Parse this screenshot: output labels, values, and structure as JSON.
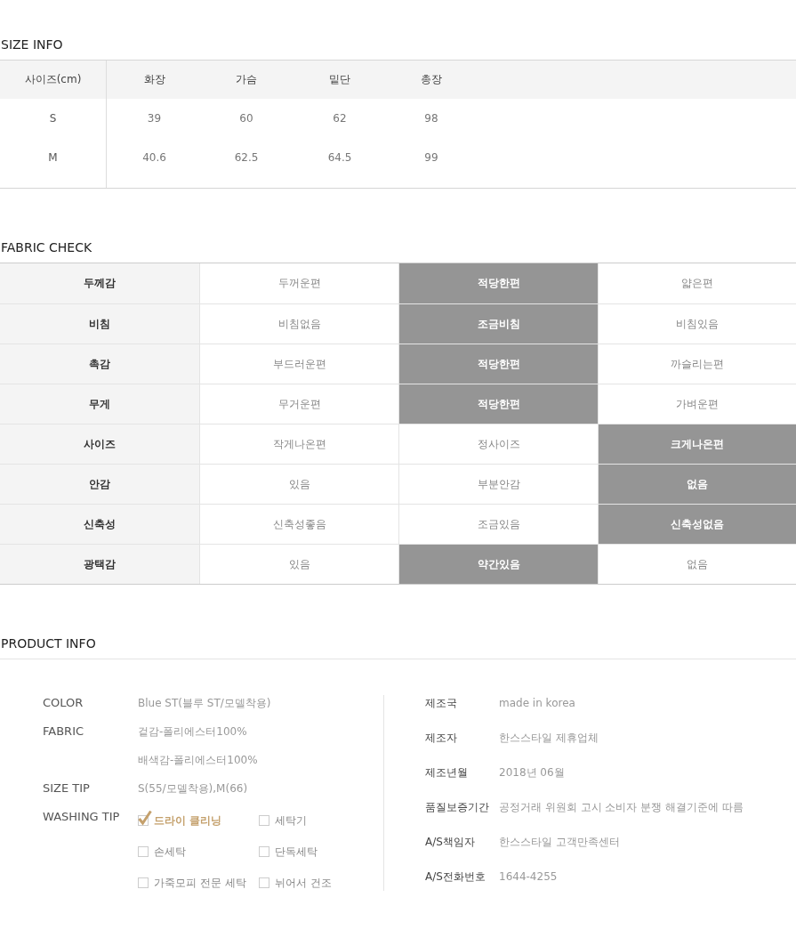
{
  "size_info": {
    "title": "SIZE INFO",
    "columns": [
      "사이즈(cm)",
      "화장",
      "가슴",
      "밑단",
      "총장"
    ],
    "rows": [
      [
        "S",
        "39",
        "60",
        "62",
        "98"
      ],
      [
        "M",
        "40.6",
        "62.5",
        "64.5",
        "99"
      ]
    ]
  },
  "fabric_check": {
    "title": "FABRIC CHECK",
    "rows": [
      {
        "label": "두께감",
        "options": [
          {
            "text": "두꺼운편",
            "selected": false
          },
          {
            "text": "적당한편",
            "selected": true
          },
          {
            "text": "얇은편",
            "selected": false
          }
        ]
      },
      {
        "label": "비침",
        "options": [
          {
            "text": "비침없음",
            "selected": false
          },
          {
            "text": "조금비침",
            "selected": true
          },
          {
            "text": "비침있음",
            "selected": false
          }
        ]
      },
      {
        "label": "촉감",
        "options": [
          {
            "text": "부드러운편",
            "selected": false
          },
          {
            "text": "적당한편",
            "selected": true
          },
          {
            "text": "까슬리는편",
            "selected": false
          }
        ]
      },
      {
        "label": "무게",
        "options": [
          {
            "text": "무거운편",
            "selected": false
          },
          {
            "text": "적당한편",
            "selected": true
          },
          {
            "text": "가벼운편",
            "selected": false
          }
        ]
      },
      {
        "label": "사이즈",
        "options": [
          {
            "text": "작게나온편",
            "selected": false
          },
          {
            "text": "정사이즈",
            "selected": false
          },
          {
            "text": "크게나온편",
            "selected": true
          }
        ]
      },
      {
        "label": "안감",
        "options": [
          {
            "text": "있음",
            "selected": false
          },
          {
            "text": "부분안감",
            "selected": false
          },
          {
            "text": "없음",
            "selected": true
          }
        ]
      },
      {
        "label": "신축성",
        "options": [
          {
            "text": "신축성좋음",
            "selected": false
          },
          {
            "text": "조금있음",
            "selected": false
          },
          {
            "text": "신축성없음",
            "selected": true
          }
        ]
      },
      {
        "label": "광택감",
        "options": [
          {
            "text": "있음",
            "selected": false
          },
          {
            "text": "약간있음",
            "selected": true
          },
          {
            "text": "없음",
            "selected": false
          }
        ]
      }
    ]
  },
  "product_info": {
    "title": "PRODUCT INFO",
    "details": [
      {
        "label": "COLOR",
        "values": [
          "Blue ST(블루 ST/모델착용)"
        ]
      },
      {
        "label": "FABRIC",
        "values": [
          "겉감-폴리에스터100%",
          "배색감-폴리에스터100%"
        ]
      },
      {
        "label": "SIZE TIP",
        "values": [
          "S(55/모델착용),M(66)"
        ]
      }
    ],
    "washing_tip": {
      "label": "WASHING TIP",
      "options": [
        {
          "label": "드라이 클리닝",
          "checked": true
        },
        {
          "label": "세탁기",
          "checked": false
        },
        {
          "label": "손세탁",
          "checked": false
        },
        {
          "label": "단독세탁",
          "checked": false
        },
        {
          "label": "가죽모피 전문 세탁",
          "checked": false
        },
        {
          "label": "뉘어서 건조",
          "checked": false
        }
      ]
    },
    "notice": [
      {
        "label": "제조국",
        "value": "made in korea"
      },
      {
        "label": "제조자",
        "value": "한스스타일 제휴업체"
      },
      {
        "label": "제조년월",
        "value": "2018년 06월"
      },
      {
        "label": "품질보증기간",
        "value": "공정거래 위원회 고시 소비자 분쟁 해결기준에 따름"
      },
      {
        "label": "A/S책임자",
        "value": "한스스타일 고객만족센터"
      },
      {
        "label": "A/S전화번호",
        "value": "1644-4255"
      }
    ]
  }
}
